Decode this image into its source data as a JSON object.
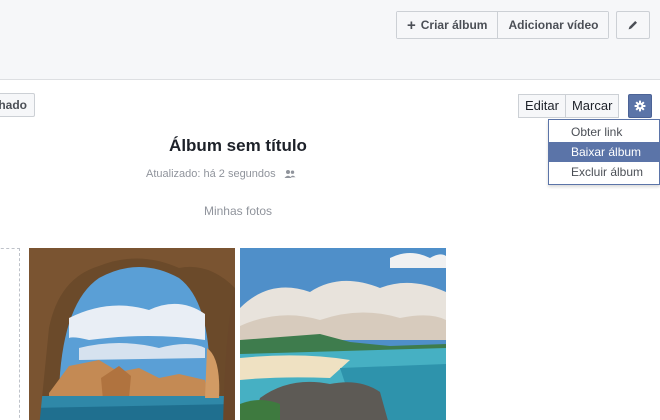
{
  "header": {
    "create_album_label": "Criar álbum",
    "add_video_label": "Adicionar vídeo"
  },
  "album": {
    "left_partial_label": "lhado",
    "edit_label": "Editar",
    "tag_label": "Marcar",
    "title": "Álbum sem título",
    "updated_text": "Atualizado: há 2 segundos",
    "subtitle": "Minhas fotos"
  },
  "options_menu": {
    "items": [
      {
        "label": "Obter link"
      },
      {
        "label": "Baixar álbum"
      },
      {
        "label": "Excluir álbum"
      }
    ],
    "selected_index": 1
  },
  "photos": [
    {
      "icon": "sea-cave-arches-photo"
    },
    {
      "icon": "beach-coast-photo"
    }
  ],
  "colors": {
    "accent": "#5b74a8",
    "background_top": "#f6f7f9",
    "muted_text": "#90949c"
  }
}
